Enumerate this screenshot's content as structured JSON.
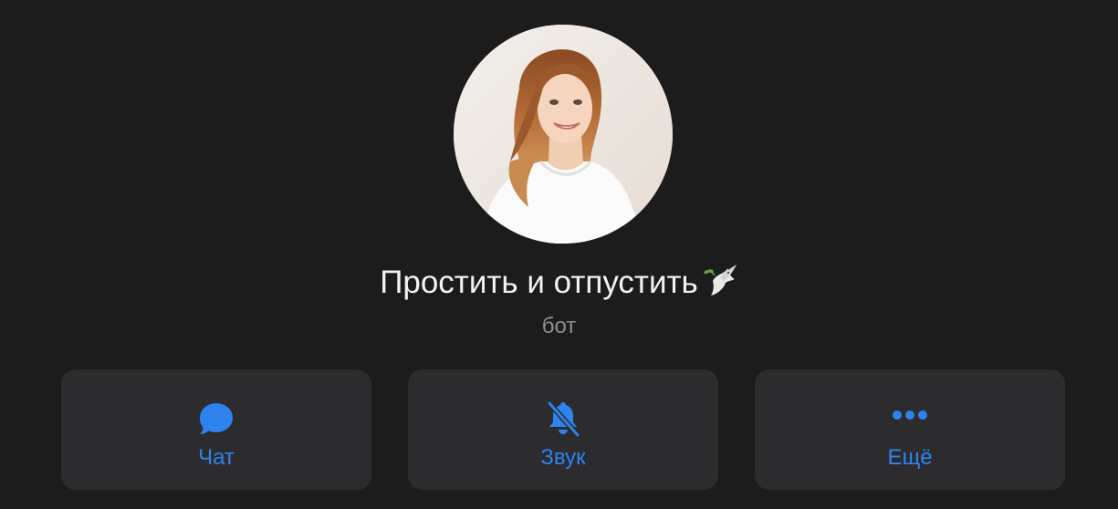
{
  "profile": {
    "name": "Простить и отпустить",
    "name_emoji_icon": "dove-icon",
    "subtitle": "бот",
    "avatar_icon": "avatar-photo"
  },
  "actions": [
    {
      "label": "Чат",
      "icon": "chat-bubble-icon"
    },
    {
      "label": "Звук",
      "icon": "bell-muted-icon"
    },
    {
      "label": "Ещё",
      "icon": "more-dots-icon"
    }
  ],
  "colors": {
    "background": "#1c1c1d",
    "button_background": "#2c2c2e",
    "accent": "#2e83ef",
    "title": "#f2f2f2",
    "subtitle": "#8e8e93"
  }
}
